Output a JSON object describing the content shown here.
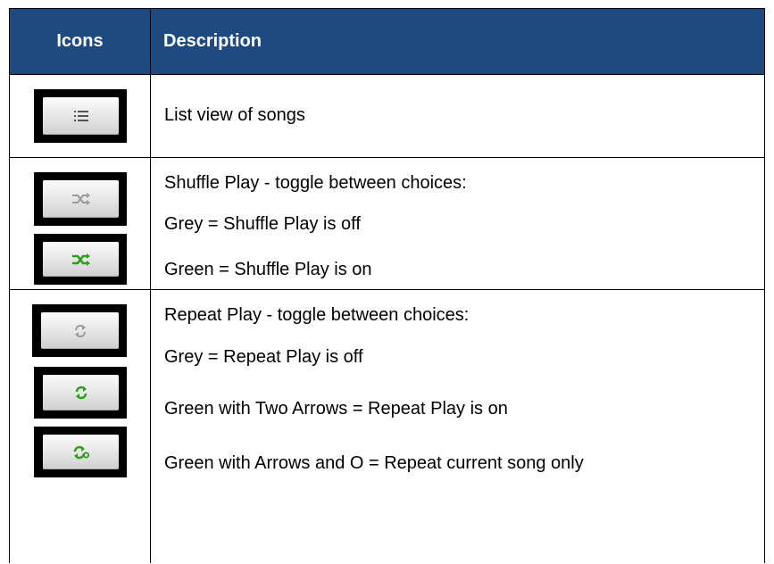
{
  "header": {
    "icons_label": "Icons",
    "description_label": "Description"
  },
  "rows": [
    {
      "name": "list-view",
      "lines": [
        "List view of songs"
      ]
    },
    {
      "name": "shuffle",
      "lines": [
        "Shuffle Play - toggle between choices:",
        "Grey = Shuffle Play is off",
        "Green = Shuffle Play is on"
      ]
    },
    {
      "name": "repeat",
      "lines": [
        "Repeat Play - toggle between choices:",
        "Grey = Repeat Play is off",
        "Green with Two Arrows = Repeat Play is on",
        "Green with Arrows and O = Repeat current song only"
      ]
    }
  ],
  "icons": {
    "list": "list-icon",
    "shuffle_off": "shuffle-grey-icon",
    "shuffle_on": "shuffle-green-icon",
    "repeat_off": "repeat-grey-icon",
    "repeat_on": "repeat-green-icon",
    "repeat_one": "repeat-one-green-icon"
  },
  "colors": {
    "header_bg": "#1f4a80",
    "icon_green": "#2e9e1a",
    "icon_grey": "#9a9a9a"
  }
}
